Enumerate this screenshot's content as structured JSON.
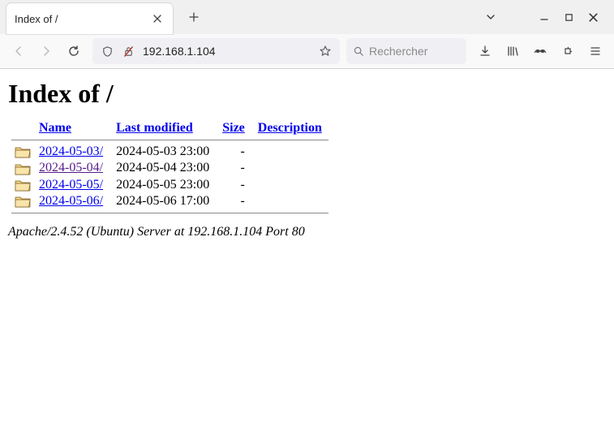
{
  "tab": {
    "title": "Index of /"
  },
  "urlbar": {
    "text": "192.168.1.104"
  },
  "searchbox": {
    "placeholder": "Rechercher"
  },
  "page": {
    "heading": "Index of /",
    "headers": {
      "name": "Name",
      "modified": "Last modified",
      "size": "Size",
      "description": "Description"
    },
    "rows": [
      {
        "name": "2024-05-03/",
        "modified": "2024-05-03 23:00",
        "size": "-",
        "visited": false
      },
      {
        "name": "2024-05-04/",
        "modified": "2024-05-04 23:00",
        "size": "-",
        "visited": true
      },
      {
        "name": "2024-05-05/",
        "modified": "2024-05-05 23:00",
        "size": "-",
        "visited": false
      },
      {
        "name": "2024-05-06/",
        "modified": "2024-05-06 17:00",
        "size": "-",
        "visited": false
      }
    ],
    "footer": "Apache/2.4.52 (Ubuntu) Server at 192.168.1.104 Port 80"
  }
}
